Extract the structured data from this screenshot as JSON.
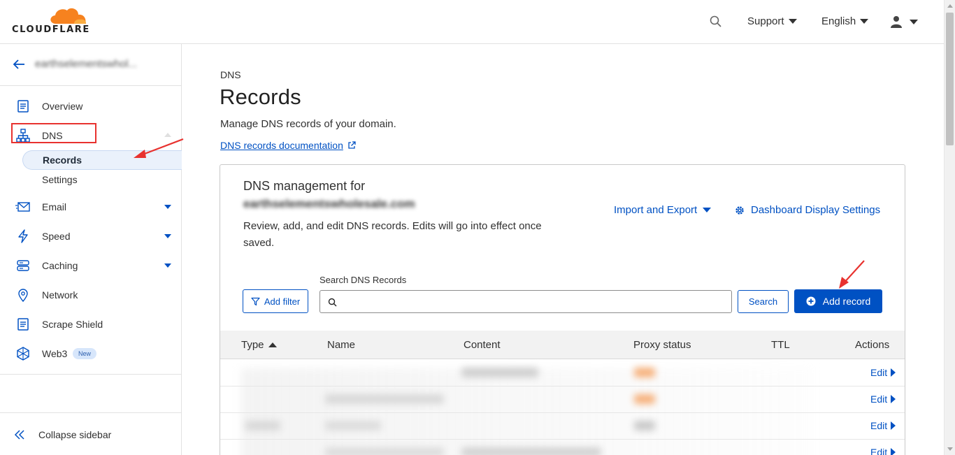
{
  "header": {
    "brand": "CLOUDFLARE",
    "support_label": "Support",
    "language_label": "English"
  },
  "sidebar": {
    "domain": "earthselementswhol...",
    "items": [
      {
        "label": "Overview",
        "icon": "document-icon"
      },
      {
        "label": "DNS",
        "icon": "sitemap-icon"
      },
      {
        "label": "Email",
        "icon": "envelope-icon"
      },
      {
        "label": "Speed",
        "icon": "lightning-icon"
      },
      {
        "label": "Caching",
        "icon": "server-icon"
      },
      {
        "label": "Network",
        "icon": "location-pin-icon"
      },
      {
        "label": "Scrape Shield",
        "icon": "document-icon"
      },
      {
        "label": "Web3",
        "icon": "web3-icon"
      }
    ],
    "dns_subitems": [
      "Records",
      "Settings"
    ],
    "web3_badge": "New",
    "collapse_label": "Collapse sidebar"
  },
  "main": {
    "eyebrow": "DNS",
    "title": "Records",
    "description": "Manage DNS records of your domain.",
    "doc_link": "DNS records documentation"
  },
  "card": {
    "title": "DNS management for",
    "domain": "earthselementswholesale.com",
    "description": "Review, add, and edit DNS records. Edits will go into effect once saved.",
    "import_export": "Import and Export",
    "display_settings": "Dashboard Display Settings",
    "add_filter": "Add filter",
    "search_label": "Search DNS Records",
    "search_value": "",
    "search_button": "Search",
    "add_record": "Add record"
  },
  "table": {
    "columns": [
      "Type",
      "Name",
      "Content",
      "Proxy status",
      "TTL",
      "Actions"
    ],
    "edit_label": "Edit"
  },
  "colors": {
    "accent": "#0051c3",
    "brand_orange": "#f6821f",
    "annotation_red": "#e8322f"
  }
}
